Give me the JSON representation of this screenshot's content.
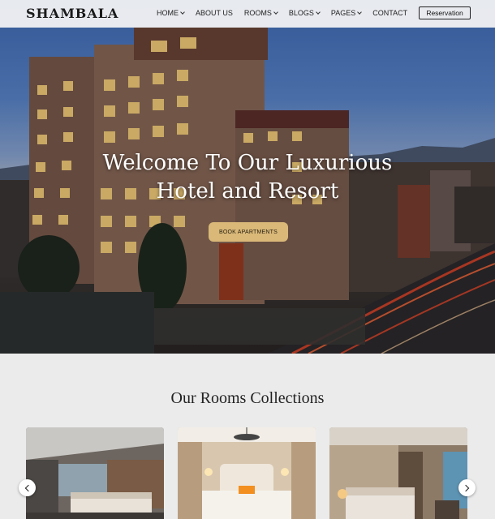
{
  "nav": {
    "logo": "SHAMBALA",
    "items": [
      {
        "label": "HOME",
        "dropdown": true
      },
      {
        "label": "ABOUT US",
        "dropdown": false
      },
      {
        "label": "ROOMS",
        "dropdown": true
      },
      {
        "label": "BLOGS",
        "dropdown": true
      },
      {
        "label": "PAGES",
        "dropdown": true
      },
      {
        "label": "CONTACT",
        "dropdown": false
      }
    ],
    "reservation_label": "Reservation"
  },
  "hero": {
    "title_line1": "Welcome To Our Luxurious",
    "title_line2": "Hotel and Resort",
    "button_label": "BOOK APARTMENTS"
  },
  "rooms": {
    "title": "Our Rooms Collections",
    "cards": [
      {
        "image": "bedroom-photo-1"
      },
      {
        "image": "bedroom-photo-2"
      },
      {
        "image": "bedroom-photo-3"
      }
    ]
  },
  "colors": {
    "accent": "#d9b878",
    "background": "#ebebeb"
  }
}
